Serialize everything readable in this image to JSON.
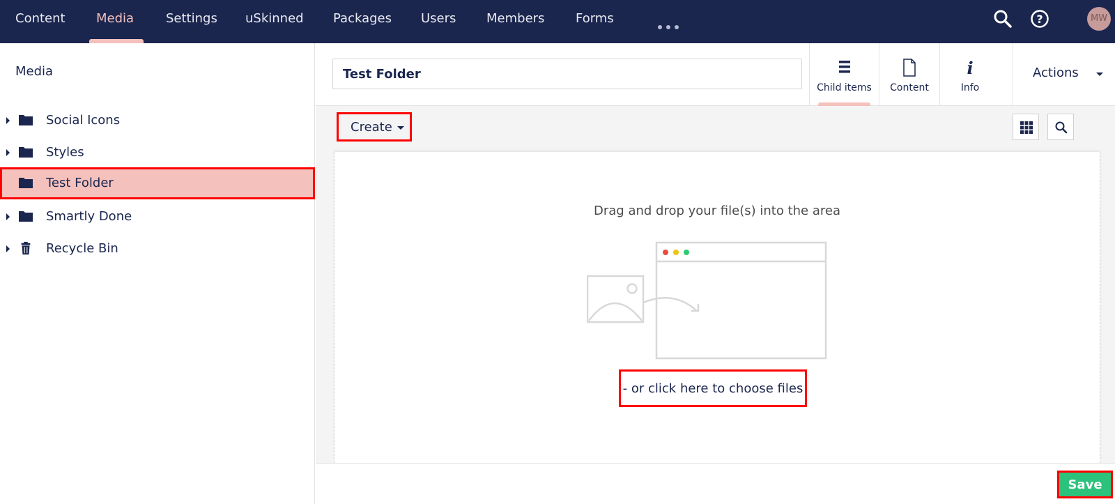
{
  "topnav": {
    "items": [
      {
        "label": "Content"
      },
      {
        "label": "Media",
        "active": true
      },
      {
        "label": "Settings"
      },
      {
        "label": "uSkinned"
      },
      {
        "label": "Packages"
      },
      {
        "label": "Users"
      },
      {
        "label": "Members"
      },
      {
        "label": "Forms"
      }
    ],
    "more_icon": "ellipsis-icon",
    "search_icon": "search-icon",
    "help_icon": "help-icon",
    "user_initials": "MW"
  },
  "sidebar": {
    "title": "Media",
    "items": [
      {
        "label": "Social Icons",
        "icon": "folder-icon",
        "expandable": true
      },
      {
        "label": "Styles",
        "icon": "folder-icon",
        "expandable": true
      },
      {
        "label": "Test Folder",
        "icon": "folder-icon",
        "expandable": false,
        "selected": true
      },
      {
        "label": "Smartly Done",
        "icon": "folder-icon",
        "expandable": true
      },
      {
        "label": "Recycle Bin",
        "icon": "trash-icon",
        "expandable": true
      }
    ]
  },
  "header": {
    "name_value": "Test Folder",
    "apps": [
      {
        "label": "Child items",
        "icon": "list-icon",
        "active": true
      },
      {
        "label": "Content",
        "icon": "document-icon"
      },
      {
        "label": "Info",
        "icon": "info-icon"
      }
    ],
    "actions_label": "Actions"
  },
  "toolbar": {
    "create_label": "Create",
    "grid_icon": "grid-icon",
    "search_icon": "search-icon"
  },
  "dropzone": {
    "instruction": "Drag and drop your file(s) into the area",
    "choose_label": "- or click here to choose files"
  },
  "footer": {
    "save_label": "Save"
  },
  "colors": {
    "nav_bg": "#1b264f",
    "accent": "#f5c1bc",
    "save": "#2bc37c",
    "highlight": "#ff0000"
  }
}
